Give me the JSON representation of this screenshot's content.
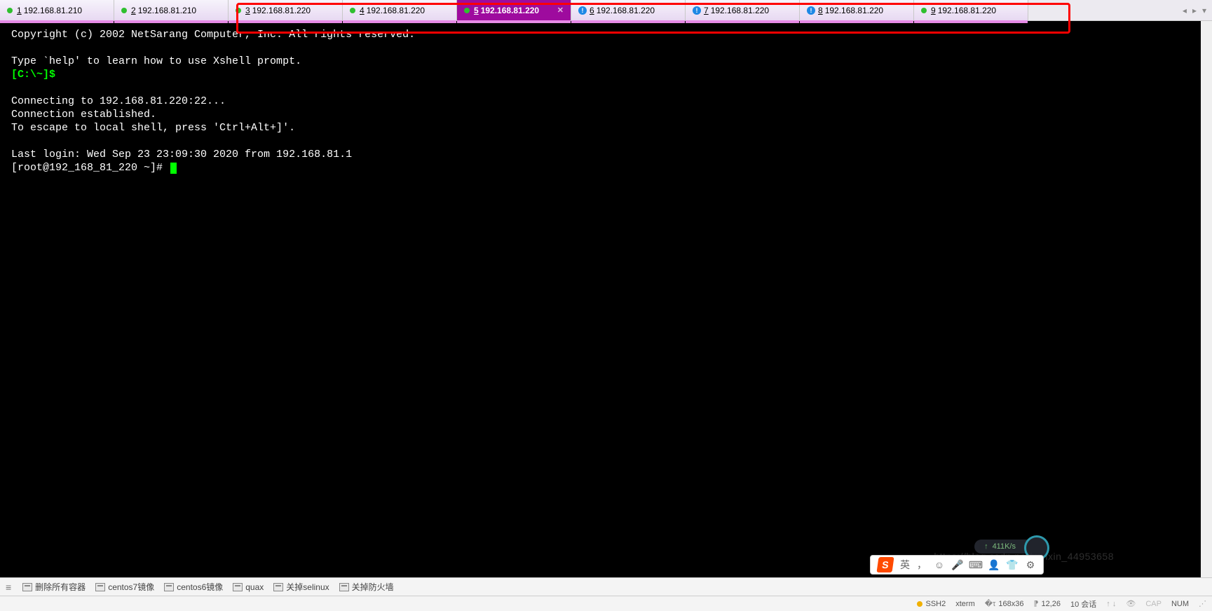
{
  "tabs": [
    {
      "num": "1",
      "ip": "192.168.81.210",
      "status": "green",
      "active": false,
      "info": false
    },
    {
      "num": "2",
      "ip": "192.168.81.210",
      "status": "green",
      "active": false,
      "info": false
    },
    {
      "num": "3",
      "ip": "192.168.81.220",
      "status": "green",
      "active": false,
      "info": false
    },
    {
      "num": "4",
      "ip": "192.168.81.220",
      "status": "green",
      "active": false,
      "info": false
    },
    {
      "num": "5",
      "ip": "192.168.81.220",
      "status": "green",
      "active": true,
      "info": false
    },
    {
      "num": "6",
      "ip": "192.168.81.220",
      "status": "info",
      "active": false,
      "info": true
    },
    {
      "num": "7",
      "ip": "192.168.81.220",
      "status": "info",
      "active": false,
      "info": true
    },
    {
      "num": "8",
      "ip": "192.168.81.220",
      "status": "info",
      "active": false,
      "info": true
    },
    {
      "num": "9",
      "ip": "192.168.81.220",
      "status": "green",
      "active": false,
      "info": false
    }
  ],
  "terminal": {
    "copyright": "Copyright (c) 2002 NetSarang Computer, Inc. All rights reserved.",
    "help": "Type `help' to learn how to use Xshell prompt.",
    "prompt1": "[C:\\~]$",
    "connecting": "Connecting to 192.168.81.220:22...",
    "established": "Connection established.",
    "escape": "To escape to local shell, press 'Ctrl+Alt+]'.",
    "lastlogin": "Last login: Wed Sep 23 23:09:30 2020 from 192.168.81.1",
    "prompt2": "[root@192_168_81_220 ~]# "
  },
  "toolbar": {
    "items": [
      "删除所有容器",
      "centos7镜像",
      "centos6镜像",
      "quax",
      "关掉selinux",
      "关掉防火墙"
    ]
  },
  "statusbar": {
    "ssh": "SSH2",
    "term": "xterm",
    "size": "168x36",
    "fontsize": "12,26",
    "sessions": "10 会话",
    "cap": "CAP",
    "num": "NUM"
  },
  "ime": {
    "lang": "英",
    "comma": "，"
  },
  "speed": {
    "value": "411K/s"
  },
  "watermark": "https://blog.csdn.net/weixin_44953658"
}
